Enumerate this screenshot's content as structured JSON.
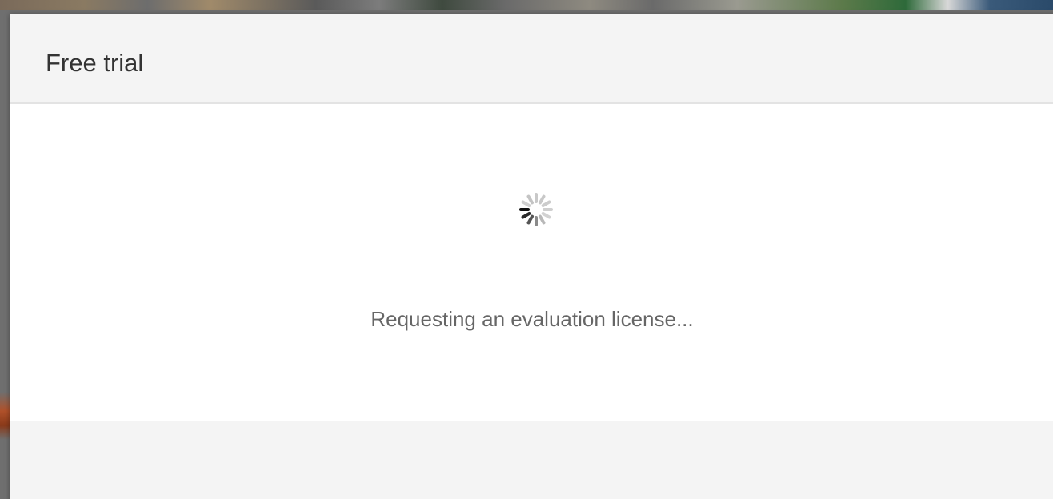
{
  "dialog": {
    "title": "Free trial",
    "status_message": "Requesting an evaluation license..."
  },
  "icons": {
    "spinner": "loading-spinner-icon"
  },
  "colors": {
    "header_bg": "#f4f4f4",
    "body_bg": "#ffffff",
    "footer_bg": "#f4f4f4",
    "title_text": "#333333",
    "status_text": "#666666"
  }
}
